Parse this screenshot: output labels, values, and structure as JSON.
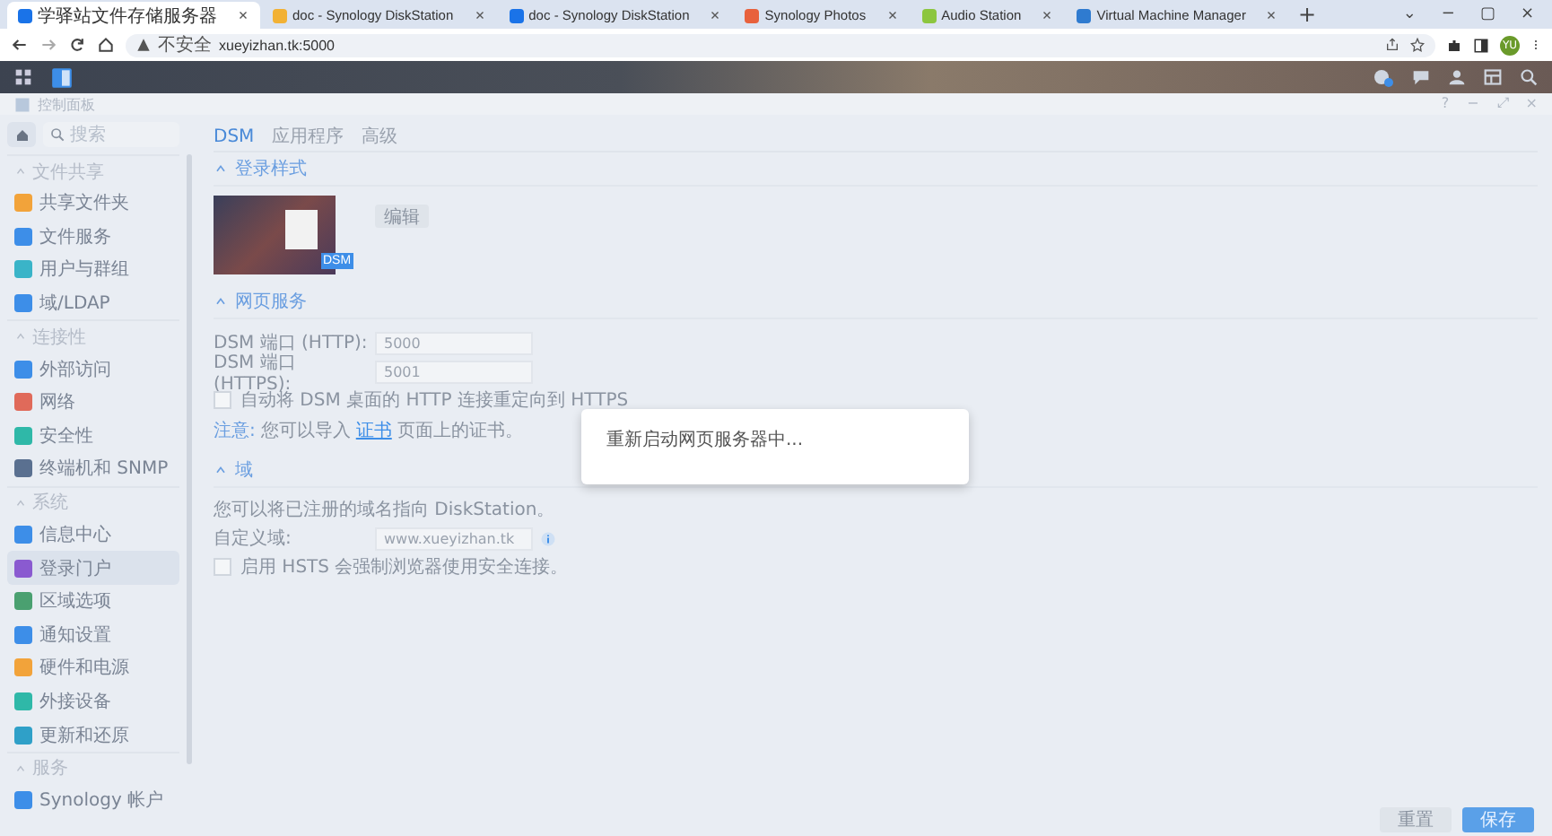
{
  "browser": {
    "tabs": [
      {
        "title": "学驿站文件存储服务器",
        "selected": true,
        "color": "#1a73e8"
      },
      {
        "title": "doc - Synology DiskStation",
        "selected": false,
        "color": "#f2b134"
      },
      {
        "title": "doc - Synology DiskStation",
        "selected": false,
        "color": "#1a73e8"
      },
      {
        "title": "Synology Photos",
        "selected": false,
        "color": "#e8613c"
      },
      {
        "title": "Audio Station",
        "selected": false,
        "color": "#8cc63f"
      },
      {
        "title": "Virtual Machine Manager",
        "selected": false,
        "color": "#2f7bd0"
      }
    ],
    "new_tab": "+",
    "window_controls": [
      "⌄",
      "−",
      "▢",
      "×"
    ],
    "security": "不安全",
    "url": "xueyizhan.tk:5000",
    "profile": "YU"
  },
  "window": {
    "title": "控制面板",
    "controls": [
      "?",
      "−",
      "⤢",
      "×"
    ]
  },
  "sidebar": {
    "search": {
      "placeholder": "搜索"
    },
    "groups": [
      {
        "label": "文件共享",
        "items": [
          {
            "label": "共享文件夹",
            "color": "#f2a33a",
            "selected": false
          },
          {
            "label": "文件服务",
            "color": "#3d8ee8",
            "selected": false
          },
          {
            "label": "用户与群组",
            "color": "#3ab4c8",
            "selected": false
          },
          {
            "label": "域/LDAP",
            "color": "#3d8ee8",
            "selected": false
          }
        ]
      },
      {
        "label": "连接性",
        "items": [
          {
            "label": "外部访问",
            "color": "#3d8ee8",
            "selected": false
          },
          {
            "label": "网络",
            "color": "#e06a5a",
            "selected": false
          },
          {
            "label": "安全性",
            "color": "#2fb8a8",
            "selected": false
          },
          {
            "label": "终端机和 SNMP",
            "color": "#5a7090",
            "selected": false
          }
        ]
      },
      {
        "label": "系统",
        "items": [
          {
            "label": "信息中心",
            "color": "#3d8ee8",
            "selected": false
          },
          {
            "label": "登录门户",
            "color": "#8a5ad0",
            "selected": true
          },
          {
            "label": "区域选项",
            "color": "#4aa070",
            "selected": false
          },
          {
            "label": "通知设置",
            "color": "#3d8ee8",
            "selected": false
          },
          {
            "label": "硬件和电源",
            "color": "#f2a33a",
            "selected": false
          },
          {
            "label": "外接设备",
            "color": "#2fb8a8",
            "selected": false
          },
          {
            "label": "更新和还原",
            "color": "#2fa0c8",
            "selected": false
          }
        ]
      },
      {
        "label": "服务",
        "items": [
          {
            "label": "Synology 帐户",
            "color": "#3d8ee8",
            "selected": false
          }
        ]
      }
    ]
  },
  "tabs": [
    {
      "label": "DSM",
      "selected": true
    },
    {
      "label": "应用程序",
      "selected": false
    },
    {
      "label": "高级",
      "selected": false
    }
  ],
  "login_style": {
    "heading": "登录样式",
    "badge": "DSM",
    "edit_button": "编辑"
  },
  "web_services": {
    "heading": "网页服务",
    "fields": [
      {
        "label": "DSM 端口 (HTTP):",
        "value": "5000"
      },
      {
        "label": "DSM 端口 (HTTPS):",
        "value": "5001"
      }
    ],
    "redirect": {
      "label": "自动将 DSM 桌面的 HTTP 连接重定向到 HTTPS",
      "checked": false
    },
    "note_label": "注意:",
    "note_before": "您可以导入",
    "note_link": "证书",
    "note_after": "页面上的证书。"
  },
  "domain": {
    "heading": "域",
    "description": "您可以将已注册的域名指向 DiskStation。",
    "field": {
      "label": "自定义域:",
      "value": "www.xueyizhan.tk"
    },
    "hsts": {
      "label": "启用 HSTS 会强制浏览器使用安全连接。",
      "checked": false
    }
  },
  "dialog": {
    "message": "重新启动网页服务器中..."
  },
  "footer": {
    "buttons": [
      {
        "label": "重置",
        "kind": "secondary"
      },
      {
        "label": "保存",
        "kind": "primary"
      }
    ]
  }
}
